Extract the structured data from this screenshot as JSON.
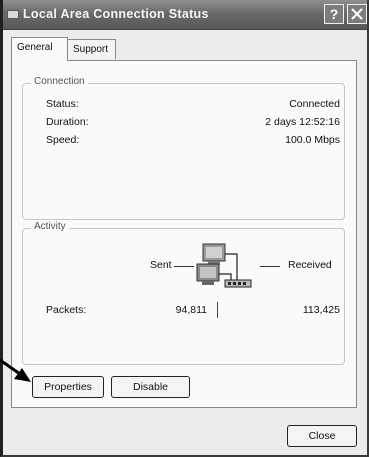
{
  "window": {
    "title": "Local Area Connection Status",
    "help_glyph": "?",
    "icons": {
      "title": "network-connection-icon",
      "close": "close-icon",
      "network": "network-activity-icon",
      "arrow": "pointer-arrow-icon"
    }
  },
  "tabs": [
    {
      "label": "General",
      "selected": true
    },
    {
      "label": "Support",
      "selected": false
    }
  ],
  "connection": {
    "legend": "Connection",
    "rows": [
      {
        "label": "Status:",
        "value": "Connected"
      },
      {
        "label": "Duration:",
        "value": "2 days 12:52:16"
      },
      {
        "label": "Speed:",
        "value": "100.0 Mbps"
      }
    ]
  },
  "activity": {
    "legend": "Activity",
    "sent_label": "Sent",
    "received_label": "Received",
    "packets_label": "Packets:",
    "packets_sent": "94,811",
    "packets_received": "113,425"
  },
  "buttons": {
    "properties": "Properties",
    "disable": "Disable",
    "close": "Close"
  }
}
